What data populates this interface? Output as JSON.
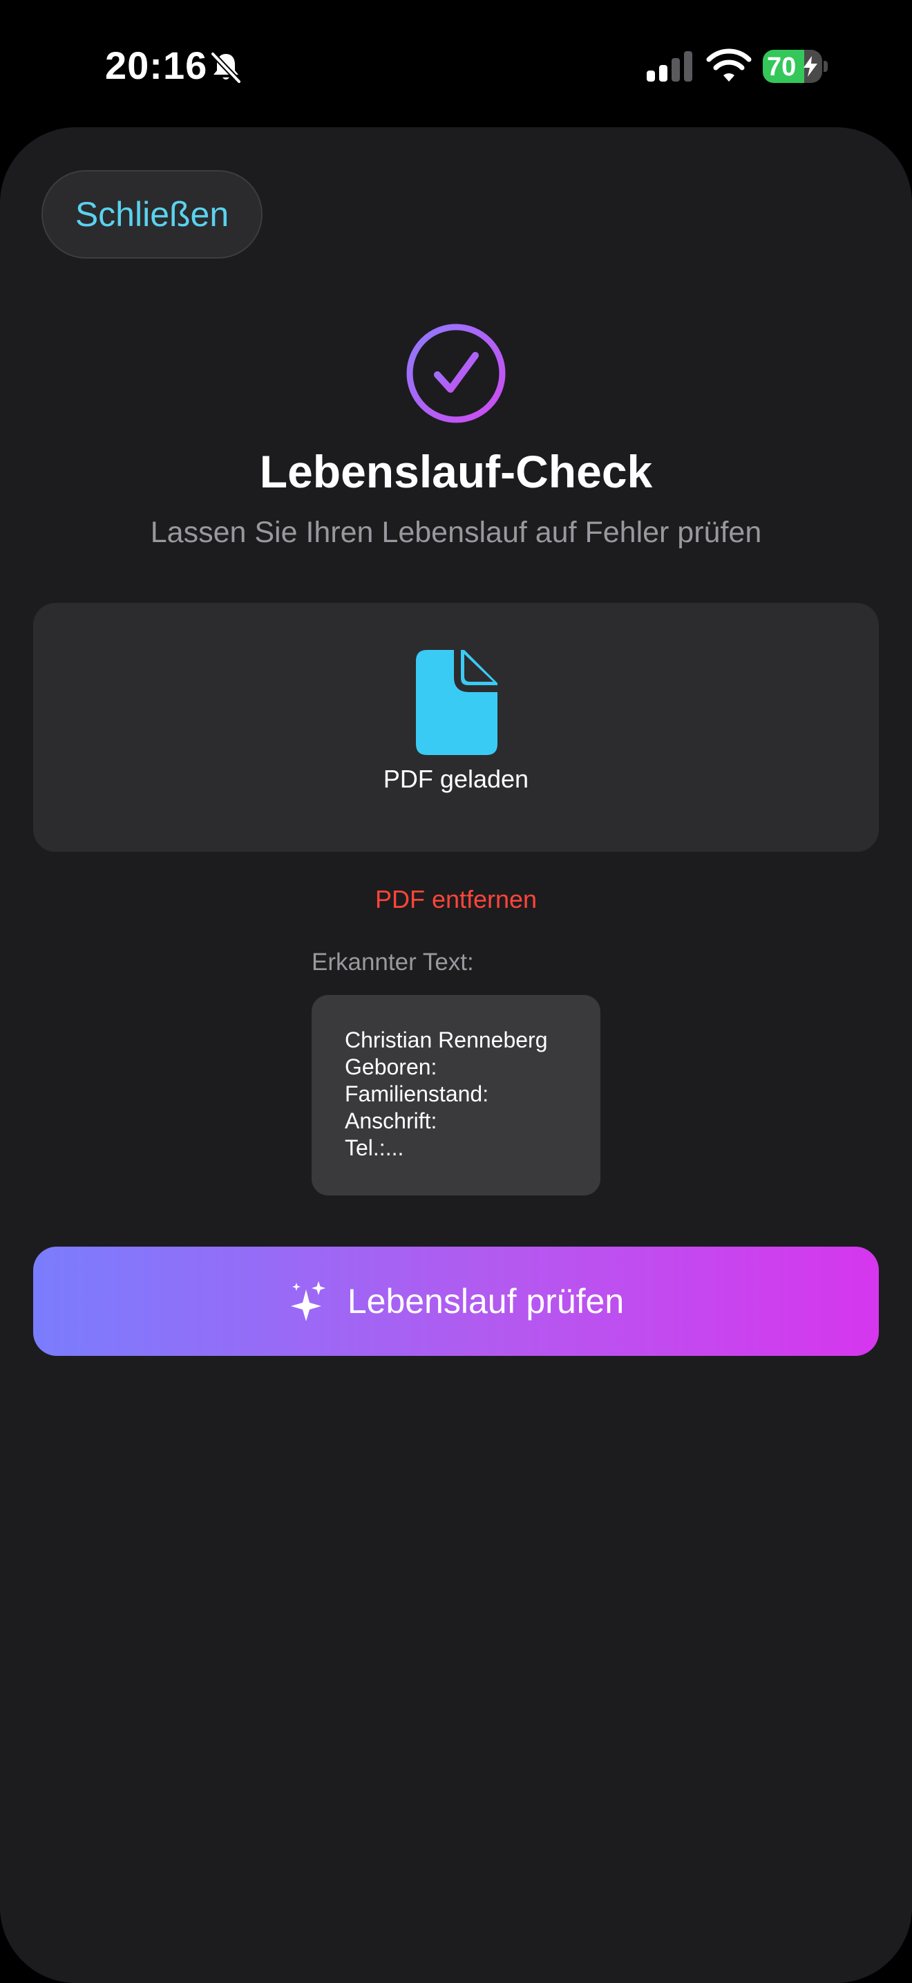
{
  "status_bar": {
    "time": "20:16",
    "battery_level": 70,
    "battery_text": "70",
    "icons": [
      "bell-slash-icon",
      "cellular-signal-icon",
      "wifi-icon",
      "battery-charging-icon"
    ]
  },
  "header": {
    "close_label": "Schließen"
  },
  "hero": {
    "icon": "checkmark-circle-icon",
    "title": "Lebenslauf-Check",
    "subtitle": "Lassen Sie Ihren Lebenslauf auf Fehler prüfen"
  },
  "pdf_card": {
    "icon": "document-icon",
    "status": "PDF geladen"
  },
  "remove_label": "PDF entfernen",
  "ocr": {
    "label": "Erkannter Text:",
    "lines": [
      "Christian Renneberg",
      "Geboren:",
      "Familienstand:",
      "Anschrift:",
      "Tel.:..."
    ]
  },
  "primary_action": {
    "icon": "sparkles-icon",
    "label": "Lebenslauf prüfen"
  },
  "colors": {
    "accent_cyan": "#5ad3f0",
    "destructive": "#ff453a",
    "gradient_start": "#7a7dfd",
    "gradient_end": "#d636ee",
    "sheet_background": "#1c1c1e"
  }
}
